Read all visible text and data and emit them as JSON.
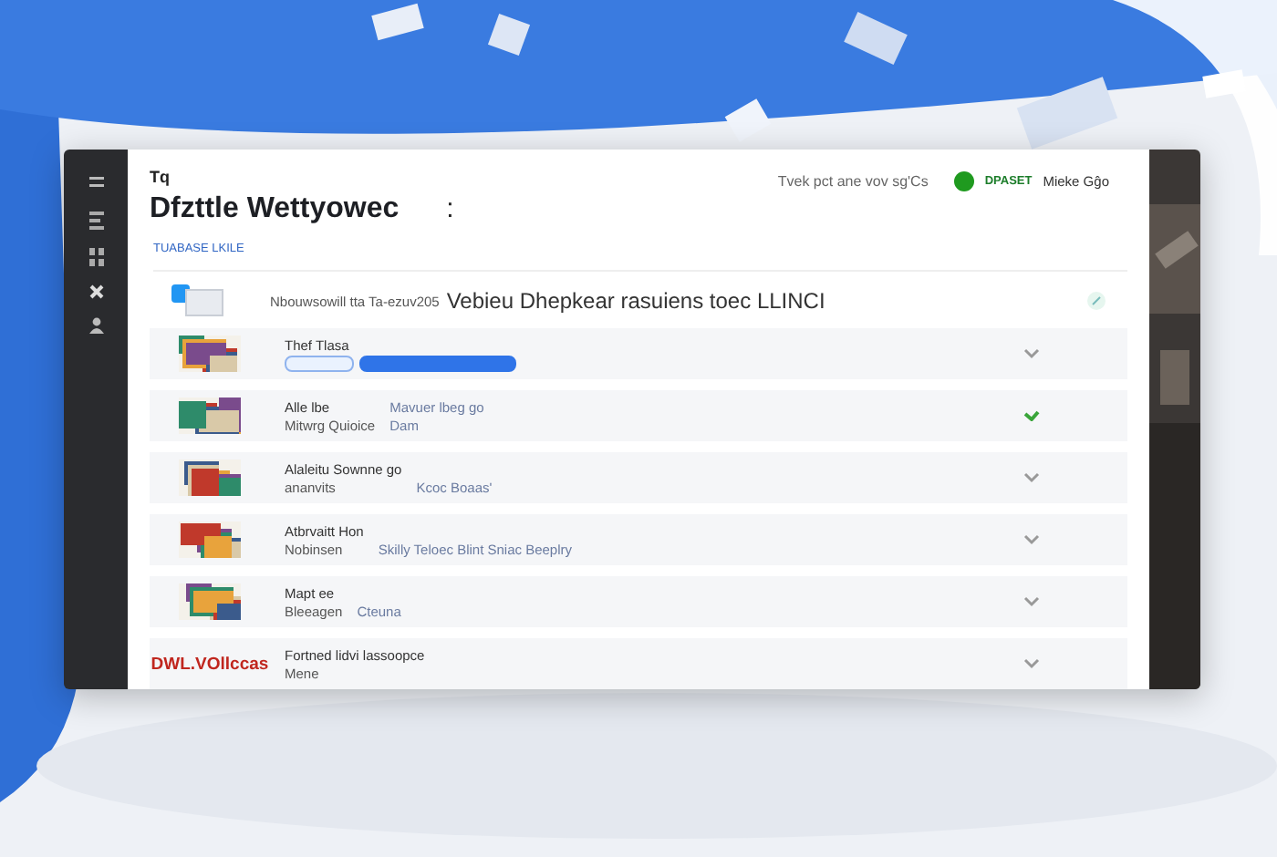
{
  "header": {
    "eyebrow": "Tq",
    "title": "Dfzttle Wettyowec",
    "menu": ":",
    "tagline": "Tvek pct ane vov sg'Cs",
    "user_label": "DPASET",
    "user_name": "Mieke Gĝo"
  },
  "section_label": "TUABASE LKILE",
  "feature": {
    "text_small": "Nbouwsowill tta Ta-ezuv205",
    "text_large": "Vebieu Dhepkear rasuiens toec LLINCI"
  },
  "rows": [
    {
      "kind": "picture",
      "title": "Thef Tlasa",
      "pills": [
        {
          "selected": false
        },
        {
          "selected": true
        }
      ],
      "checked": false
    },
    {
      "kind": "picture",
      "title": "Alle lbe",
      "subtitle": "Mitwrg Quioice",
      "col2_line1": "Mavuer lbeg go",
      "col2_line2": "Dam",
      "checked": true
    },
    {
      "kind": "picture",
      "title": "Alaleitu Sownne go",
      "subtitle": "ananvits",
      "col2_line2": "Kcoc Boaas'",
      "checked": false
    },
    {
      "kind": "picture",
      "title": "Atbrvaitt Hon",
      "subtitle": "Nobinsen",
      "col2_line2": "Skilly Teloec Blint Sniac Beeplry",
      "checked": false
    },
    {
      "kind": "picture",
      "title": "Mapt ee",
      "subtitle": "Bleeagen",
      "col2_line2": "Cteuna",
      "checked": false
    },
    {
      "kind": "logo",
      "logo": "DWL.VOllccas",
      "title": "Fortned lidvi lassoopce",
      "subtitle": "Mene",
      "checked": false
    }
  ]
}
